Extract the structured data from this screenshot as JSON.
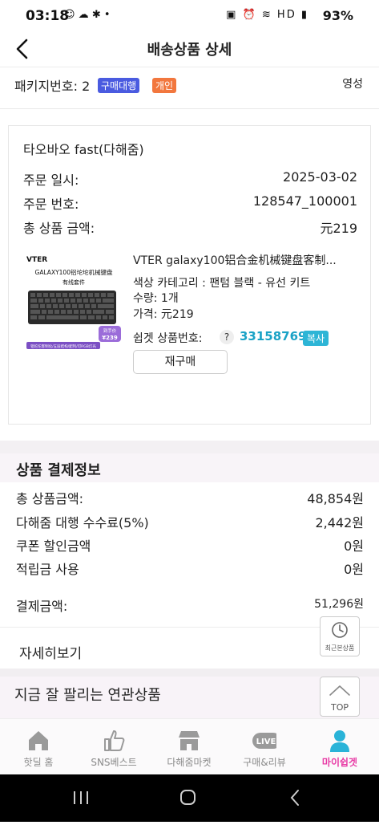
{
  "status": {
    "time": "03:18",
    "notif_icons": "☺ ☁ ✱ •",
    "sys_icons": "▣ ⏰ ≋ HD ▮",
    "battery": "93%"
  },
  "header": {
    "title": "배송상품 상세"
  },
  "package": {
    "label": "패키지번호: 2",
    "badge_service": "구매대행",
    "badge_type": "개인",
    "warehouse": "영성"
  },
  "order": {
    "store": "타오바오 fast(다해줌)",
    "date_label": "주문 일시:",
    "date_value": "2025-03-02",
    "number_label": "주문 번호:",
    "number_value": "128547_100001",
    "total_label": "총 상품 금액:",
    "total_value": "元219",
    "product": {
      "name": "VTER galaxy100铝合金机械键盘客制...",
      "option": "색상 카테고리 : 팬텀 블랙 - 유선 키트",
      "qty": "수량: 1개",
      "price": "가격: 元219",
      "id_label": "쉽겟 상품번호:",
      "id_help": "?",
      "id_value": "33158769",
      "copy_label": "복사",
      "rebuy_label": "재구매",
      "thumb_brand": "VTER",
      "thumb_title": "GALAXY100铝坨坨机械键盘",
      "thumb_sub": "有线套件",
      "thumb_price_tag": "到手价",
      "thumb_price": "¥239",
      "thumb_banner": "铝坨坨客制化/五层结构/配列/可RGB灯光"
    }
  },
  "payment": {
    "title": "상품 결제정보",
    "rows": [
      {
        "label": "총 상품금액:",
        "value": "48,854원"
      },
      {
        "label": "다해줌 대행 수수료(5%)",
        "value": "2,442원"
      },
      {
        "label": "쿠폰 할인금액",
        "value": "0원"
      },
      {
        "label": "적립금 사용",
        "value": "0원"
      }
    ],
    "final_label": "결제금액:",
    "final_value": "51,296원"
  },
  "detail_label": "자세히보기",
  "related_title": "지금 잘 팔리는 연관상품",
  "floating": {
    "recent_label": "최근본상품",
    "top_label": "TOP"
  },
  "tabs": [
    {
      "label": "핫딜 홈"
    },
    {
      "label": "SNS베스트"
    },
    {
      "label": "다해줌마켓"
    },
    {
      "label": "구매&리뷰",
      "icon_text": "LIVE"
    },
    {
      "label": "마이쉽겟"
    }
  ],
  "colors": {
    "accent": "#e83aa5",
    "link": "#19a2c6",
    "badge_blue": "#4a5be0",
    "badge_orange": "#f2773e"
  }
}
